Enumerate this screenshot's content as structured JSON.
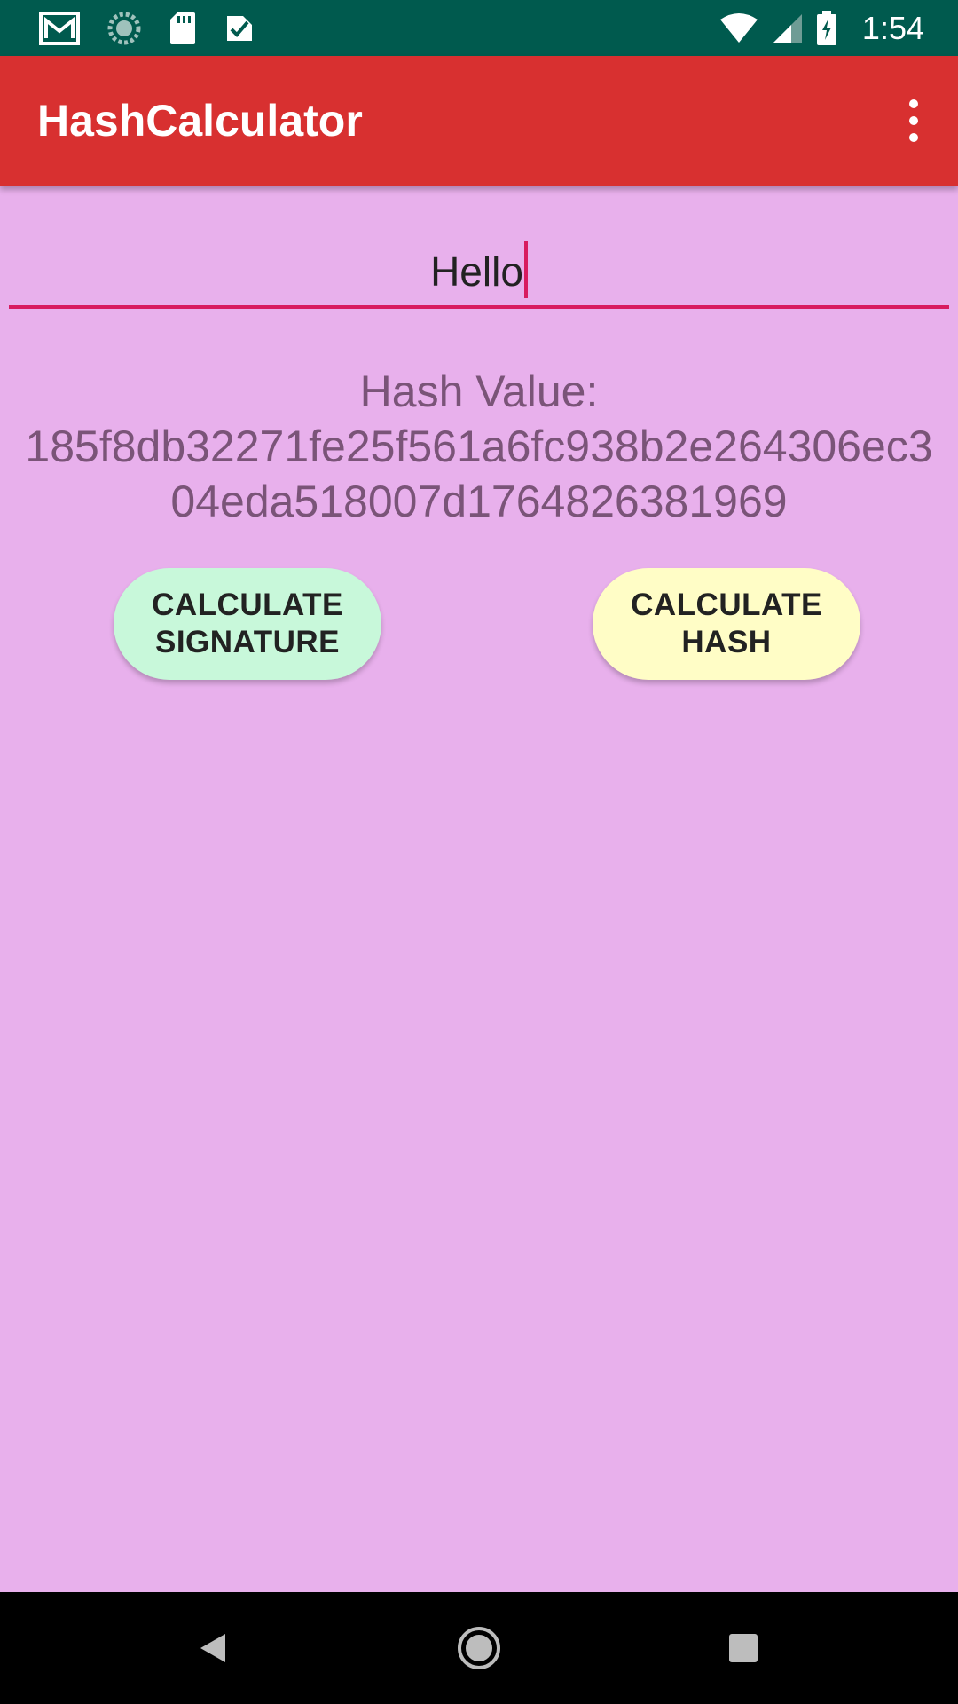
{
  "status_bar": {
    "time": "1:54",
    "left_icons": [
      "gmail-icon",
      "sync-icon",
      "sd-card-icon",
      "task-check-icon"
    ],
    "right_icons": [
      "wifi-icon",
      "cell-signal-icon",
      "battery-charging-icon"
    ]
  },
  "app_bar": {
    "title": "HashCalculator",
    "menu_icon": "overflow-menu-icon"
  },
  "input": {
    "value": "Hello",
    "accent_color": "#D81B60"
  },
  "hash": {
    "label": "Hash Value:",
    "value": "185f8db32271fe25f561a6fc938b2e264306ec304eda518007d1764826381969"
  },
  "buttons": {
    "signature_label": "CALCULATE SIGNATURE",
    "hash_label": "CALCULATE HASH",
    "signature_color": "#C8F8DA",
    "hash_color": "#FFFDC6"
  },
  "nav_bar": {
    "icons": [
      "back-icon",
      "home-icon",
      "recents-icon"
    ]
  },
  "colors": {
    "status_bar": "#005A4E",
    "app_bar": "#D83030",
    "background": "#E8B0EC",
    "hash_text": "#7A5478"
  }
}
